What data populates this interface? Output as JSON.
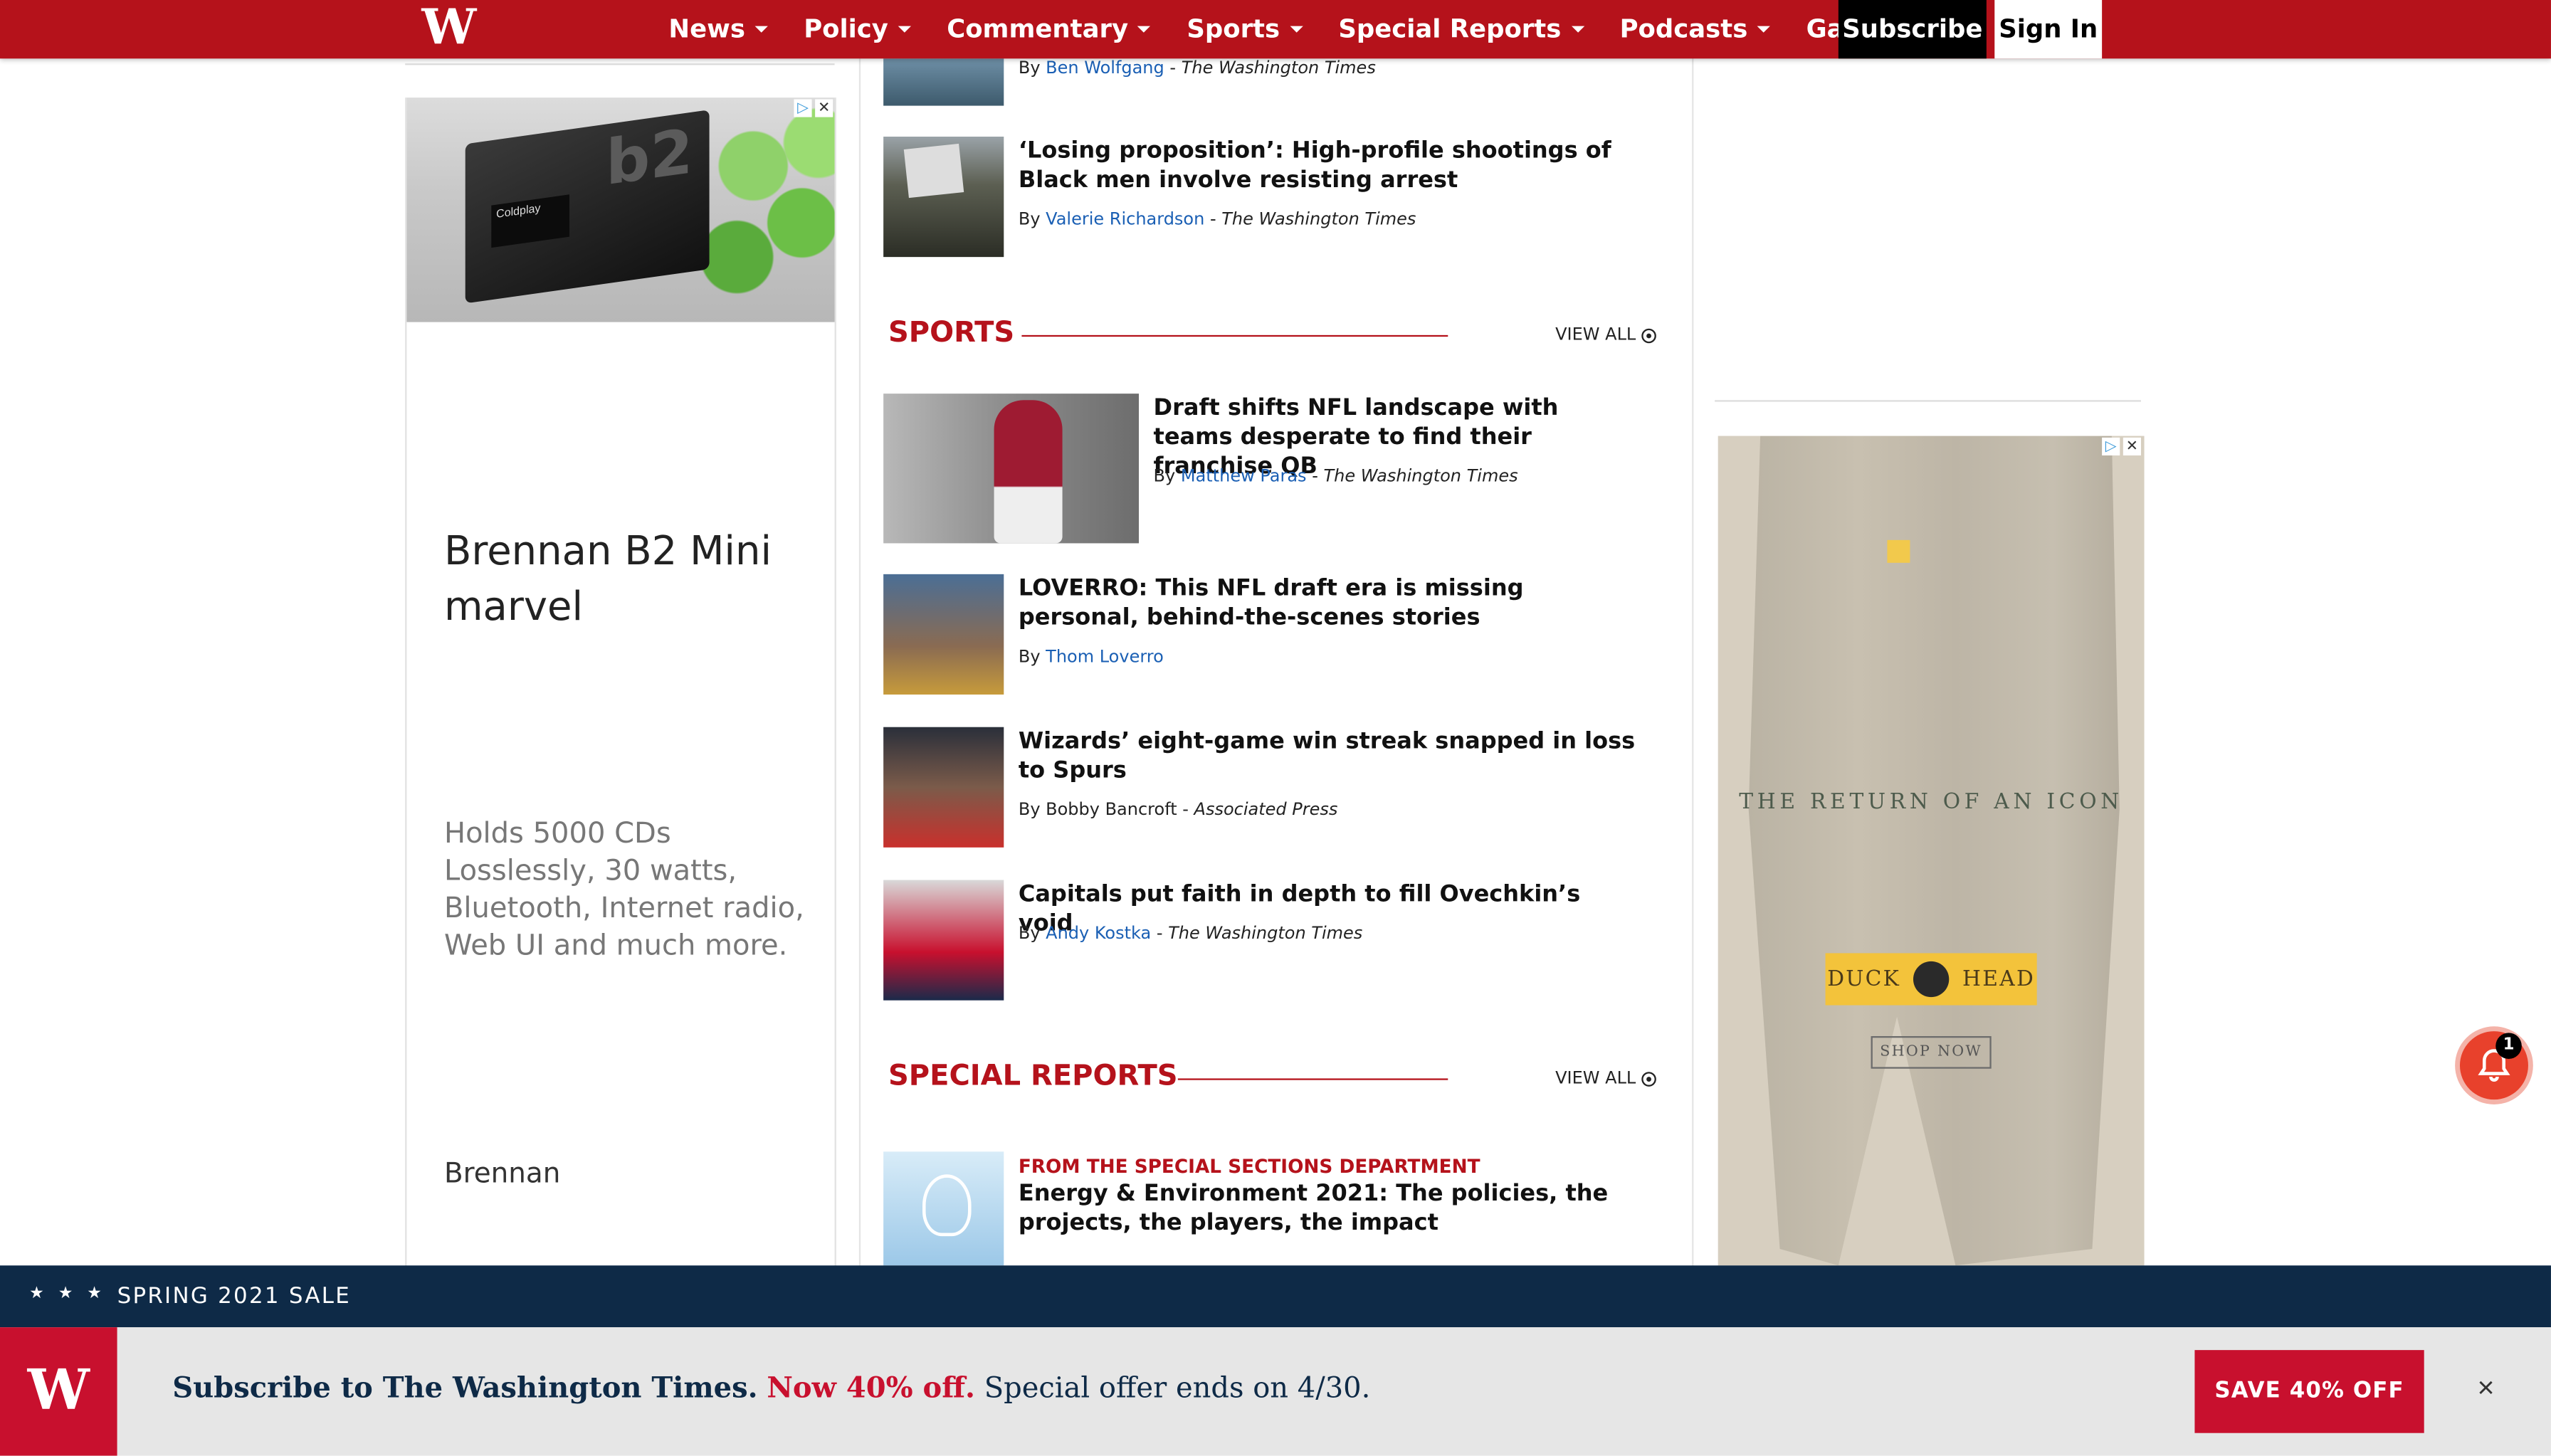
{
  "nav": {
    "logo": "W",
    "items": [
      "News",
      "Policy",
      "Commentary",
      "Sports",
      "Special Reports",
      "Podcasts",
      "Games"
    ],
    "subscribe": "Subscribe",
    "signin": "Sign In"
  },
  "left_ad": {
    "screen_text": "Coldplay",
    "brand_mark": "b2",
    "headline": "Brennan B2 Mini marvel",
    "body": "Holds 5000 CDs Losslessly, 30 watts, Bluetooth, Internet radio, Web UI and much more.",
    "brand": "Brennan",
    "choice_icons": [
      "▷",
      "✕"
    ]
  },
  "articles_top": [
    {
      "by": "By",
      "author": "Ben Wolfgang",
      "sep": " - ",
      "pub": "The Washington Times"
    },
    {
      "title": "‘Losing proposition’: High-profile shootings of Black men involve resisting arrest",
      "by": "By",
      "author": "Valerie Richardson",
      "sep": " - ",
      "pub": "The Washington Times"
    }
  ],
  "sports": {
    "title": "SPORTS",
    "view_all": "VIEW ALL",
    "articles": [
      {
        "title": "Draft shifts NFL landscape with teams desperate to find their franchise QB",
        "by": "By",
        "author": "Matthew Paras",
        "sep": " - ",
        "pub": "The Washington Times"
      },
      {
        "title": "LOVERRO: This NFL draft era is missing personal, behind-the-scenes stories",
        "by": "By",
        "author": "Thom Loverro"
      },
      {
        "title": "Wizards’ eight-game win streak snapped in loss to Spurs",
        "by": "By Bobby Bancroft",
        "sep": " - ",
        "pub": "Associated Press"
      },
      {
        "title": "Capitals put faith in depth to fill Ovechkin’s void",
        "by": "By",
        "author": "Andy Kostka",
        "sep": " - ",
        "pub": "The Washington Times"
      }
    ]
  },
  "special_reports": {
    "title": "SPECIAL REPORTS",
    "view_all": "VIEW ALL",
    "kicker": "FROM THE SPECIAL SECTIONS DEPARTMENT",
    "article_title": "Energy & Environment 2021: The policies, the projects, the players, the impact"
  },
  "right_ad": {
    "tagline": "THE RETURN OF AN ICON",
    "brand_left": "DUCK",
    "brand_right": "HEAD",
    "cta": "SHOP NOW",
    "choice_icons": [
      "▷",
      "✕"
    ]
  },
  "notification": {
    "count": "1"
  },
  "banner": {
    "stars": "★ ★ ★",
    "sale": "SPRING 2021 SALE",
    "logo": "W",
    "text_main": "Subscribe to The Washington Times.",
    "text_offer": "Now 40% off.",
    "text_tail": "Special offer ends on 4/30.",
    "cta": "SAVE 40% OFF",
    "close": "×"
  },
  "colors": {
    "brand_red": "#b5121b",
    "navy": "#0e2a47",
    "link_blue": "#1a5fb4",
    "promo_red": "#c8102e"
  }
}
